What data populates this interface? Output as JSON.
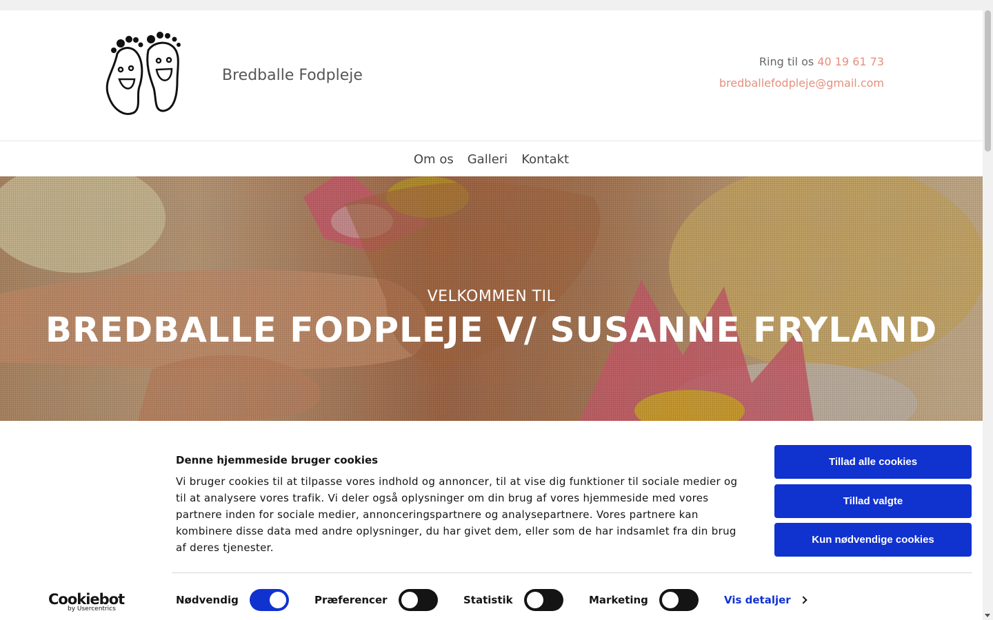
{
  "header": {
    "site_name": "Bredballe Fodpleje",
    "phone_prefix": "Ring til os",
    "phone": "40 19 61 73",
    "email": "bredballefodpleje@gmail.com",
    "accent_color": "#e58f7c"
  },
  "nav": {
    "items": [
      {
        "label": "Om os"
      },
      {
        "label": "Galleri"
      },
      {
        "label": "Kontakt"
      }
    ]
  },
  "hero": {
    "kicker": "VELKOMMEN TIL",
    "title": "BREDBALLE FODPLEJE V/ SUSANNE FRYLAND"
  },
  "cookie": {
    "brand": "Cookiebot",
    "brand_sub": "by Usercentrics",
    "title": "Denne hjemmeside bruger cookies",
    "text": "Vi bruger cookies til at tilpasse vores indhold og annoncer, til at vise dig funktioner til sociale medier og til at analysere vores trafik. Vi deler også oplysninger om din brug af vores hjemmeside med vores partnere inden for sociale medier, annonceringspartnere og analysepartnere. Vores partnere kan kombinere disse data med andre oplysninger, du har givet dem, eller som de har indsamlet fra din brug af deres tjenester.",
    "buttons": {
      "allow_all": "Tillad alle cookies",
      "allow_selected": "Tillad valgte",
      "necessary_only": "Kun nødvendige cookies"
    },
    "toggles": [
      {
        "label": "Nødvendig",
        "on": true
      },
      {
        "label": "Præferencer",
        "on": false
      },
      {
        "label": "Statistik",
        "on": false
      },
      {
        "label": "Marketing",
        "on": false
      }
    ],
    "details_link": "Vis detaljer",
    "primary_color": "#1032cf"
  }
}
